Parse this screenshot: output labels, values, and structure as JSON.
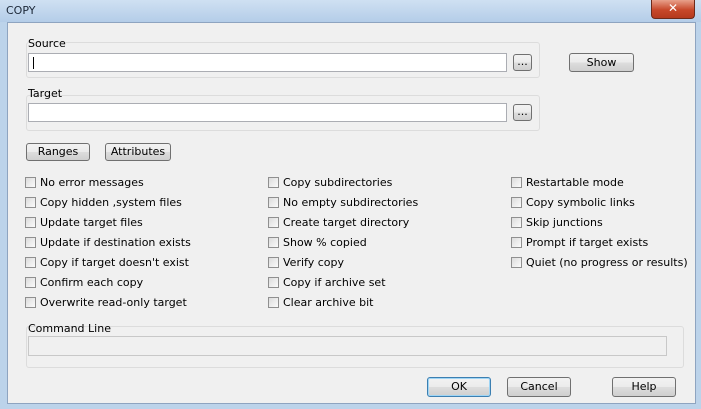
{
  "window": {
    "title": "COPY",
    "close_glyph": "✕"
  },
  "source": {
    "label": "Source",
    "value": "",
    "browse_label": "...",
    "show_label": "Show"
  },
  "target": {
    "label": "Target",
    "value": "",
    "browse_label": "..."
  },
  "buttons": {
    "ranges": "Ranges",
    "attributes": "Attributes",
    "ok": "OK",
    "cancel": "Cancel",
    "help": "Help"
  },
  "options": {
    "col1": [
      {
        "label": "No error messages",
        "checked": false
      },
      {
        "label": "Copy hidden ,system files",
        "checked": false
      },
      {
        "label": "Update target files",
        "checked": false
      },
      {
        "label": "Update if destination exists",
        "checked": false
      },
      {
        "label": "Copy if target doesn't exist",
        "checked": false
      },
      {
        "label": "Confirm each copy",
        "checked": false
      },
      {
        "label": "Overwrite read-only target",
        "checked": false
      }
    ],
    "col2": [
      {
        "label": "Copy subdirectories",
        "checked": false
      },
      {
        "label": "No empty subdirectories",
        "checked": false
      },
      {
        "label": "Create target directory",
        "checked": false
      },
      {
        "label": "Show % copied",
        "checked": false
      },
      {
        "label": "Verify copy",
        "checked": false
      },
      {
        "label": "Copy if archive set",
        "checked": false
      },
      {
        "label": "Clear archive bit",
        "checked": false
      }
    ],
    "col3": [
      {
        "label": "Restartable mode",
        "checked": false
      },
      {
        "label": "Copy symbolic links",
        "checked": false
      },
      {
        "label": "Skip junctions",
        "checked": false
      },
      {
        "label": "Prompt if target exists",
        "checked": false
      },
      {
        "label": "Quiet (no progress or results)",
        "checked": false
      }
    ]
  },
  "command_line": {
    "label": "Command Line",
    "value": ""
  }
}
